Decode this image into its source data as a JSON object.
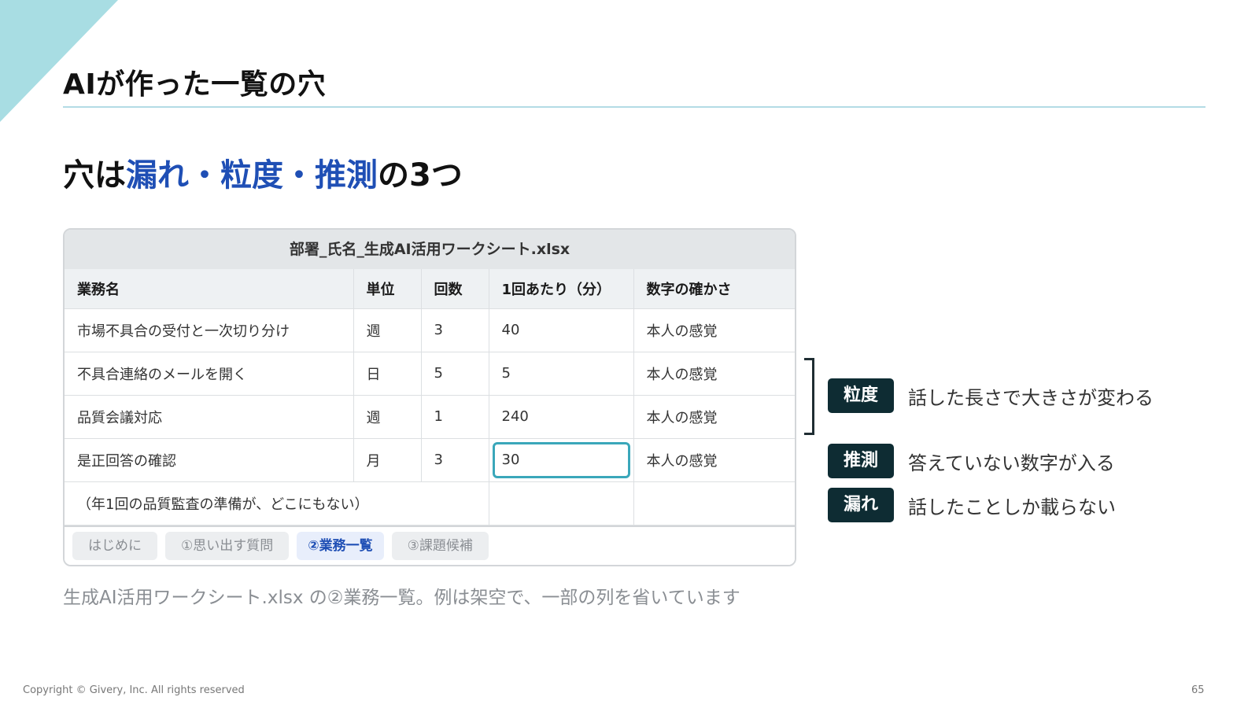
{
  "page": {
    "title": "AIが作った一覧の穴",
    "headline": {
      "prefix": "穴は",
      "term1": "漏れ",
      "sep1": "・",
      "term2": "粒度",
      "sep2": "・",
      "term3": "推測",
      "suffix": "の3つ"
    },
    "accent_color": "#1f4fb5"
  },
  "spreadsheet": {
    "filename": "部署_氏名_生成AI活用ワークシート.xlsx",
    "columns": [
      "業務名",
      "単位",
      "回数",
      "1回あたり（分）",
      "数字の確かさ"
    ],
    "rows": [
      [
        "市場不具合の受付と一次切り分け",
        "週",
        "3",
        "40",
        "本人の感覚"
      ],
      [
        "不具合連絡のメールを開く",
        "日",
        "5",
        "5",
        "本人の感覚"
      ],
      [
        "品質会議対応",
        "週",
        "1",
        "240",
        "本人の感覚"
      ],
      [
        "是正回答の確認",
        "月",
        "3",
        "30",
        "本人の感覚"
      ]
    ],
    "missing_row_note": "（年1回の品質監査の準備が、どこにもない）",
    "selected_cell": "30",
    "tabs": [
      {
        "label": "はじめに",
        "active": false
      },
      {
        "label": "①思い出す質問",
        "active": false
      },
      {
        "label": "②業務一覧",
        "active": true
      },
      {
        "label": "③課題候補",
        "active": false
      }
    ]
  },
  "caption": "生成AI活用ワークシート.xlsx の②業務一覧。例は架空で、一部の列を省いています",
  "issues": [
    {
      "tag": "粒度",
      "text": "話した長さで大きさが変わる"
    },
    {
      "tag": "推測",
      "text": "答えていない数字が入る"
    },
    {
      "tag": "漏れ",
      "text": "話したことしか載らない"
    }
  ],
  "footer": {
    "copyright": "Copyright © Givery, Inc. All rights reserved",
    "page_number": "65"
  }
}
